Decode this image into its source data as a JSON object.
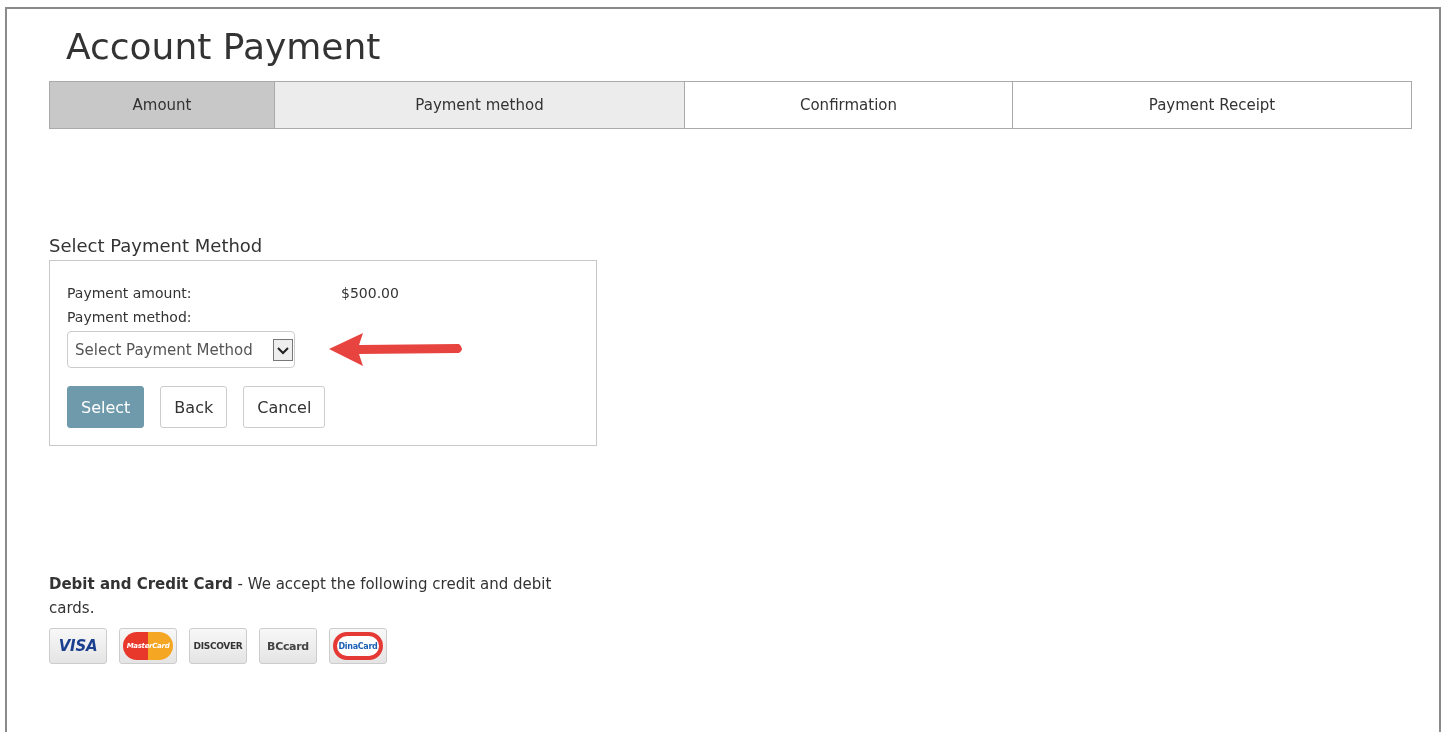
{
  "page_title": "Account Payment",
  "steps": [
    {
      "label": "Amount",
      "selected": true,
      "highlighted": false
    },
    {
      "label": "Payment method",
      "selected": false,
      "highlighted": true
    },
    {
      "label": "Confirmation",
      "selected": false,
      "highlighted": false
    },
    {
      "label": "Payment Receipt",
      "selected": false,
      "highlighted": false
    }
  ],
  "section_title": "Select Payment Method",
  "form": {
    "amount_label": "Payment amount:",
    "amount_value": "$500.00",
    "method_label": "Payment method:",
    "method_select": {
      "value": "Select Payment Method"
    },
    "buttons": [
      {
        "label": "Select",
        "kind": "primary"
      },
      {
        "label": "Back",
        "kind": "secondary"
      },
      {
        "label": "Cancel",
        "kind": "secondary"
      }
    ]
  },
  "cards_info": {
    "text": "**Debit and Credit Card** - We accept the following credit and debit cards.",
    "cards": [
      {
        "label": "VISA",
        "kind": "visa"
      },
      {
        "label": "MasterCard",
        "kind": "mastercard"
      },
      {
        "label": "DISCOVER",
        "kind": "discover"
      },
      {
        "label": "BCcard",
        "kind": "bccard"
      },
      {
        "label": "DinaCard",
        "kind": "dinacard"
      }
    ]
  }
}
